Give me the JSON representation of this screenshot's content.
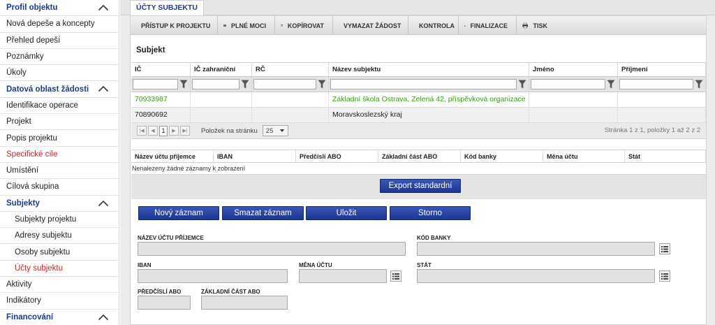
{
  "sidebar": {
    "items": [
      {
        "label": "Profil objektu",
        "type": "section"
      },
      {
        "label": "Nová depeše a koncepty",
        "type": "item"
      },
      {
        "label": "Přehled depeší",
        "type": "item"
      },
      {
        "label": "Poznámky",
        "type": "item"
      },
      {
        "label": "Úkoly",
        "type": "item"
      },
      {
        "label": "Datová oblast žádosti",
        "type": "section"
      },
      {
        "label": "Identifikace operace",
        "type": "item"
      },
      {
        "label": "Projekt",
        "type": "item"
      },
      {
        "label": "Popis projektu",
        "type": "item"
      },
      {
        "label": "Specifické cíle",
        "type": "item-red"
      },
      {
        "label": "Umístění",
        "type": "item"
      },
      {
        "label": "Cílová skupina",
        "type": "item"
      },
      {
        "label": "Subjekty",
        "type": "section"
      },
      {
        "label": "Subjekty projektu",
        "type": "sub"
      },
      {
        "label": "Adresy subjektu",
        "type": "sub"
      },
      {
        "label": "Osoby subjektu",
        "type": "sub"
      },
      {
        "label": "Účty subjektu",
        "type": "sub-active"
      },
      {
        "label": "Aktivity",
        "type": "item"
      },
      {
        "label": "Indikátory",
        "type": "item"
      },
      {
        "label": "Financování",
        "type": "section"
      }
    ]
  },
  "tab": {
    "label": "ÚČTY SUBJEKTU"
  },
  "toolbar": {
    "access": "PŘÍSTUP K PROJEKTU",
    "powers": "PLNÉ MOCI",
    "copy": "KOPÍROVAT",
    "delete_request": "VYMAZAT ŽÁDOST",
    "check": "KONTROLA",
    "finalize": "FINALIZACE",
    "print": "TISK"
  },
  "subject": {
    "title": "Subjekt",
    "columns": [
      "IČ",
      "IČ zahraniční",
      "RČ",
      "Název subjektu",
      "Jméno",
      "Příjmení"
    ],
    "rows": [
      [
        "70933987",
        "",
        "",
        "Základní škola Ostrava, Zelená 42, příspěvková organizace",
        "",
        ""
      ],
      [
        "70890692",
        "",
        "",
        "Moravskoslezský kraj",
        "",
        ""
      ]
    ]
  },
  "pager": {
    "first": "|◀",
    "prev": "◀",
    "page": "1",
    "next": "▶",
    "last": "▶|",
    "per_page_label": "Položek na stránku",
    "per_page_value": "25",
    "info": "Stránka 1 z 1, položky 1 až 2 z 2"
  },
  "accounts": {
    "columns": [
      "Název účtu příjemce",
      "IBAN",
      "Předčíslí ABO",
      "Základní část ABO",
      "Kód banky",
      "Měna účtu",
      "Stát"
    ],
    "empty_text": "Nenalezeny žádné záznamy k zobrazení",
    "export_label": "Export standardní"
  },
  "actions": {
    "new": "Nový záznam",
    "delete": "Smazat záznam",
    "save": "Uložit",
    "cancel": "Storno"
  },
  "form": {
    "account_name_label": "NÁZEV ÚČTU PŘÍJEMCE",
    "bank_code_label": "KÓD BANKY",
    "iban_label": "IBAN",
    "currency_label": "MĚNA ÚČTU",
    "state_label": "STÁT",
    "prefix_label": "PŘEDČÍSLÍ ABO",
    "base_label": "ZÁKLADNÍ ČÁST ABO"
  }
}
